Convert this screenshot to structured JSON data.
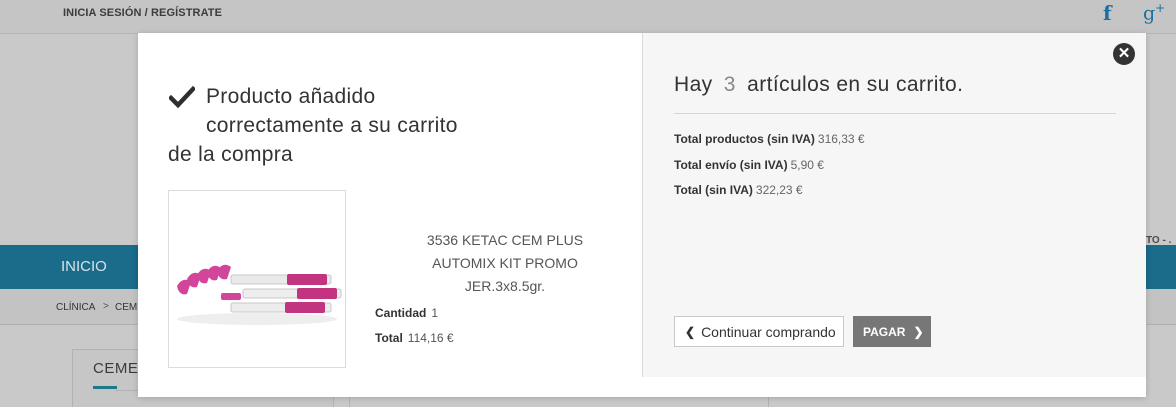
{
  "topbar": {
    "login_label": "INICIA SESIÓN / REGÍSTRATE",
    "facebook_glyph": "f",
    "gplus_glyph": "g",
    "gplus_sup": "+"
  },
  "header": {
    "right_fragment": "TO - ."
  },
  "nav": {
    "home_label": "INICIO"
  },
  "breadcrumb": {
    "item1": "CLÍNICA",
    "separator": ">",
    "item2": "CEMI"
  },
  "sidebar": {
    "title": "CEME"
  },
  "modal": {
    "close_glyph": "✕",
    "added_line1": "Producto añadido",
    "added_line2": "correctamente a su carrito",
    "added_line3": "de la compra",
    "product": {
      "name_line1": "3536 KETAC CEM PLUS",
      "name_line2": "AUTOMIX KIT PROMO",
      "name_line3": "JER.3x8.5gr.",
      "qty_label": "Cantidad",
      "qty_value": "1",
      "total_label": "Total",
      "total_value": "114,16 €"
    },
    "cart": {
      "title_prefix": "Hay",
      "count": "3",
      "title_suffix": "artículos en su carrito.",
      "products_label": "Total productos (sin IVA)",
      "products_value": "316,33 €",
      "shipping_label": "Total envío (sin IVA)",
      "shipping_value": "5,90 €",
      "total_label": "Total (sin IVA)",
      "total_value": "322,23 €",
      "continue_label": "Continuar comprando",
      "pay_label": "PAGAR"
    }
  },
  "colors": {
    "nav_bg": "#1b6b8b",
    "pay_button": "#777777",
    "accent_teal": "#1b7a86"
  }
}
